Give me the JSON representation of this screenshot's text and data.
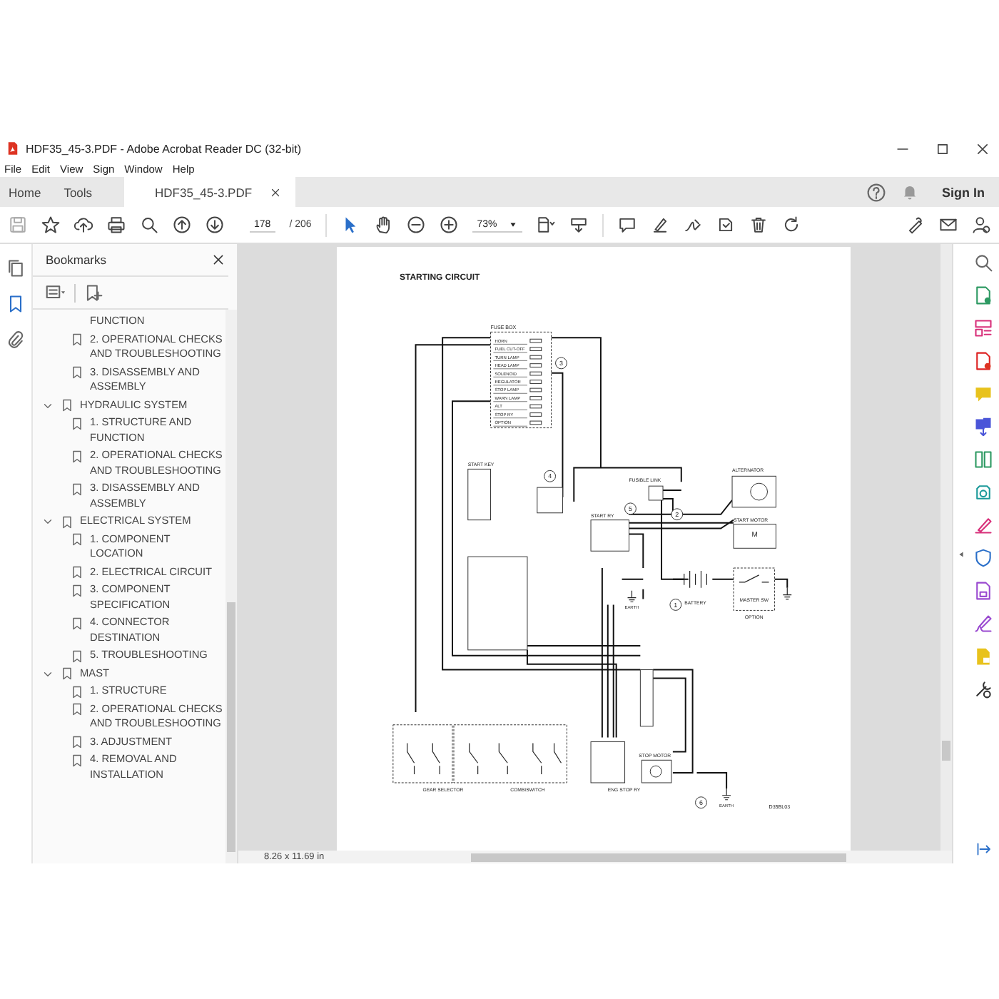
{
  "window": {
    "title": "HDF35_45-3.PDF - Adobe Acrobat Reader DC (32-bit)"
  },
  "menu": [
    "File",
    "Edit",
    "View",
    "Sign",
    "Window",
    "Help"
  ],
  "tabs": [
    {
      "label": "Home",
      "selected": false
    },
    {
      "label": "Tools",
      "selected": false
    },
    {
      "label": "HDF35_45-3.PDF",
      "selected": true
    }
  ],
  "account": {
    "sign_in": "Sign In"
  },
  "toolbar": {
    "page": "178",
    "page_count": "/ 206",
    "zoom": "73%"
  },
  "nav_rail": [
    {
      "kind": "pages",
      "selected": false
    },
    {
      "kind": "bookmarks",
      "selected": true
    },
    {
      "kind": "attachments",
      "selected": false
    }
  ],
  "bookmarks": {
    "title": "Bookmarks",
    "continued_tail": "FUNCTION",
    "continued": [
      {
        "label": "2. OPERATIONAL CHECKS AND TROUBLESHOOTING"
      },
      {
        "label": "3. DISASSEMBLY AND ASSEMBLY"
      }
    ],
    "items": [
      {
        "label": "HYDRAULIC SYSTEM",
        "expanded": true,
        "children": [
          {
            "label": "1. STRUCTURE AND FUNCTION"
          },
          {
            "label": "2. OPERATIONAL CHECKS AND TROUBLESHOOTING"
          },
          {
            "label": "3. DISASSEMBLY AND ASSEMBLY"
          }
        ]
      },
      {
        "label": "ELECTRICAL SYSTEM",
        "expanded": true,
        "children": [
          {
            "label": "1. COMPONENT LOCATION"
          },
          {
            "label": "2. ELECTRICAL CIRCUIT"
          },
          {
            "label": "3. COMPONENT SPECIFICATION"
          },
          {
            "label": "4. CONNECTOR DESTINATION"
          },
          {
            "label": "5. TROUBLESHOOTING"
          }
        ]
      },
      {
        "label": "MAST",
        "expanded": true,
        "children": [
          {
            "label": "1. STRUCTURE"
          },
          {
            "label": "2. OPERATIONAL CHECKS AND TROUBLESHOOTING"
          },
          {
            "label": "3. ADJUSTMENT"
          },
          {
            "label": "4. REMOVAL AND INSTALLATION"
          }
        ]
      }
    ]
  },
  "page": {
    "title": "STARTING CIRCUIT",
    "figure_code": "D35BL03",
    "diagram": {
      "fuse_box": {
        "label": "FUSE BOX",
        "fuses": [
          "HORN",
          "FUEL CUT-OFF",
          "TURN LAMP",
          "HEAD LAMP",
          "SOLENOID",
          "REGULATOR",
          "STOP LAMP",
          "WARN LAMP",
          "ALT",
          "STOP RY",
          "OPTION"
        ]
      },
      "start_key": "START KEY",
      "fusible_link": "FUSIBLE LINK",
      "alternator": "ALTERNATOR",
      "start_relay": "START RY",
      "start_motor": "START MOTOR",
      "motor_symbol": "M",
      "battery": "BATTERY",
      "master_switch": "MASTER SW",
      "option": "OPTION",
      "gear_selector": "GEAR SELECTOR",
      "combiswitch": "COMBISWITCH",
      "eng_stop_relay": "ENG STOP RY",
      "stop_motor": "STOP MOTOR",
      "earth_labels": [
        "EARTH",
        "EARTH"
      ],
      "callouts": [
        "1",
        "2",
        "3",
        "4",
        "5",
        "6"
      ]
    }
  },
  "status": {
    "page_size": "8.26 x 11.69 in"
  }
}
